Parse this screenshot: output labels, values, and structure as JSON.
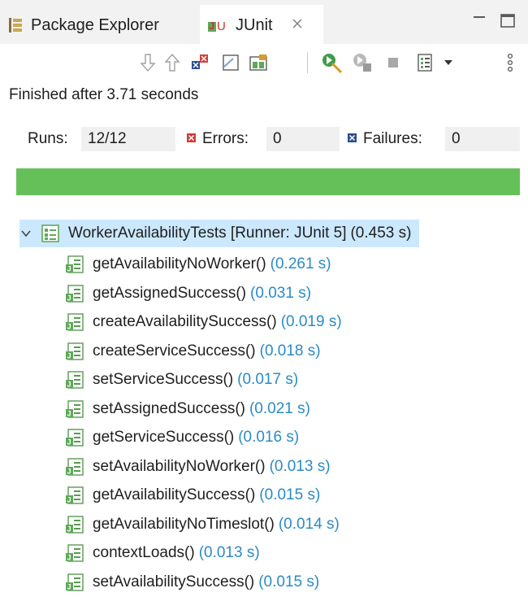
{
  "tabs": {
    "package_explorer": "Package Explorer",
    "junit": "JUnit"
  },
  "status": {
    "finished": "Finished after 3.71 seconds"
  },
  "counters": {
    "runs_label": "Runs:",
    "runs_value": "12/12",
    "errors_label": "Errors:",
    "errors_value": "0",
    "failures_label": "Failures:",
    "failures_value": "0"
  },
  "progress": {
    "fraction": 1.0,
    "color": "#66c05a"
  },
  "tree": {
    "root": {
      "name": "WorkerAvailabilityTests [Runner: JUnit 5]",
      "time": "(0.453 s)"
    },
    "tests": [
      {
        "name": "getAvailabilityNoWorker()",
        "time": "(0.261 s)"
      },
      {
        "name": "getAssignedSuccess()",
        "time": "(0.031 s)"
      },
      {
        "name": "createAvailabilitySuccess()",
        "time": "(0.019 s)"
      },
      {
        "name": "createServiceSuccess()",
        "time": "(0.018 s)"
      },
      {
        "name": "setServiceSuccess()",
        "time": "(0.017 s)"
      },
      {
        "name": "setAssignedSuccess()",
        "time": "(0.021 s)"
      },
      {
        "name": "getServiceSuccess()",
        "time": "(0.016 s)"
      },
      {
        "name": "setAvailabilityNoWorker()",
        "time": "(0.013 s)"
      },
      {
        "name": "getAvailabilitySuccess()",
        "time": "(0.015 s)"
      },
      {
        "name": "getAvailabilityNoTimeslot()",
        "time": "(0.014 s)"
      },
      {
        "name": "contextLoads()",
        "time": "(0.013 s)"
      },
      {
        "name": "setAvailabilitySuccess()",
        "time": "(0.015 s)"
      }
    ]
  },
  "icons": {
    "toolbar": [
      "next-failure-icon",
      "previous-failure-icon",
      "show-failures-only-icon",
      "scroll-lock-icon",
      "show-skipped-icon",
      "rerun-icon",
      "rerun-failed-first-icon",
      "stop-icon",
      "test-run-history-icon",
      "view-menu-icon"
    ],
    "test_status": "test-success-icon"
  }
}
